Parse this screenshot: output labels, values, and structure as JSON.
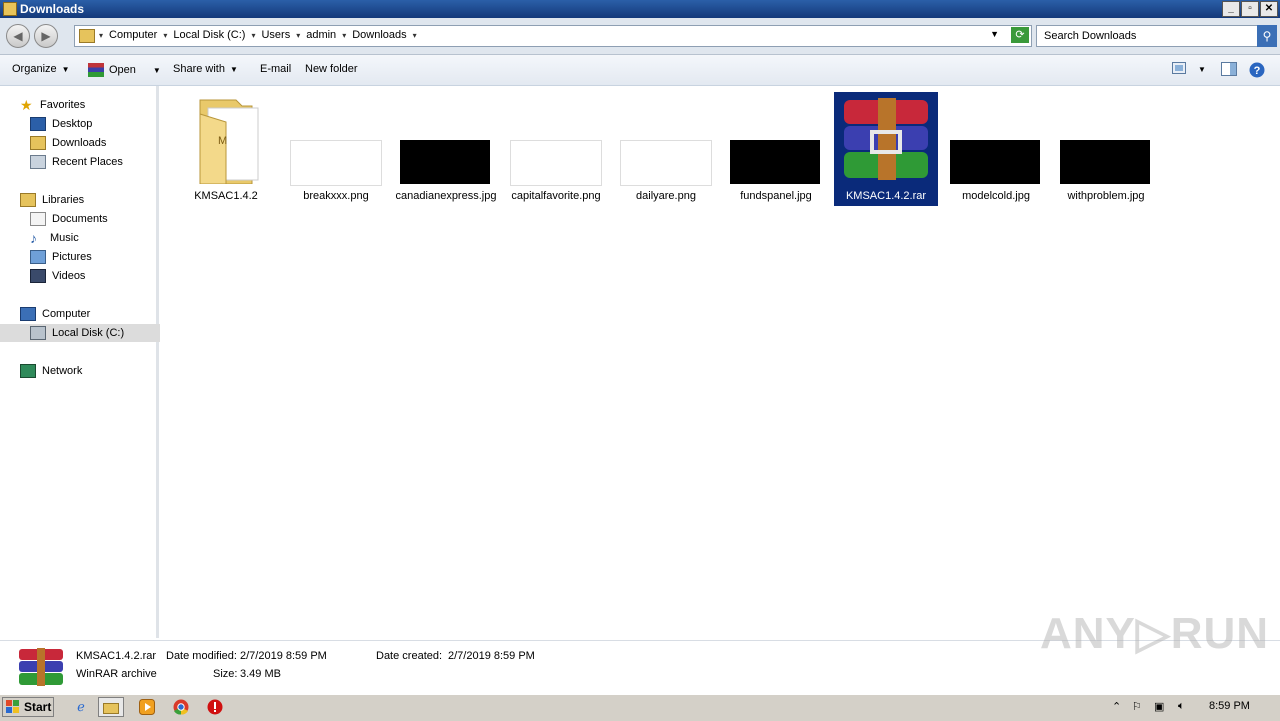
{
  "window": {
    "title": "Downloads"
  },
  "window_controls": [
    "_",
    "▫",
    "✕"
  ],
  "address": {
    "crumbs": [
      "Computer",
      "Local Disk (C:)",
      "Users",
      "admin",
      "Downloads"
    ]
  },
  "search": {
    "placeholder": "Search Downloads"
  },
  "toolbar": {
    "organize": "Organize",
    "open": "Open",
    "share": "Share with",
    "email": "E-mail",
    "new_folder": "New folder"
  },
  "sidebar": {
    "favorites": "Favorites",
    "desktop": "Desktop",
    "downloads": "Downloads",
    "recent": "Recent Places",
    "libraries": "Libraries",
    "documents": "Documents",
    "music": "Music",
    "pictures": "Pictures",
    "videos": "Videos",
    "computer": "Computer",
    "local_disk": "Local Disk (C:)",
    "network": "Network"
  },
  "files": [
    {
      "name": "KMSAC1.4.2",
      "kind": "folder"
    },
    {
      "name": "breakxxx.png",
      "kind": "white-thumb"
    },
    {
      "name": "canadianexpress.jpg",
      "kind": "black-thumb"
    },
    {
      "name": "capitalfavorite.png",
      "kind": "white-thumb"
    },
    {
      "name": "dailyare.png",
      "kind": "white-thumb"
    },
    {
      "name": "fundspanel.jpg",
      "kind": "black-thumb"
    },
    {
      "name": "KMSAC1.4.2.rar",
      "kind": "winrar",
      "selected": true
    },
    {
      "name": "modelcold.jpg",
      "kind": "black-thumb"
    },
    {
      "name": "withproblem.jpg",
      "kind": "black-thumb"
    }
  ],
  "details": {
    "name": "KMSAC1.4.2.rar",
    "type": "WinRAR archive",
    "modified_label": "Date modified:",
    "modified": "2/7/2019 8:59 PM",
    "created_label": "Date created:",
    "created": "2/7/2019 8:59 PM",
    "size_label": "Size:",
    "size": "3.49 MB"
  },
  "taskbar": {
    "start": "Start",
    "clock": "8:59 PM"
  },
  "watermark": "ANY▷RUN"
}
